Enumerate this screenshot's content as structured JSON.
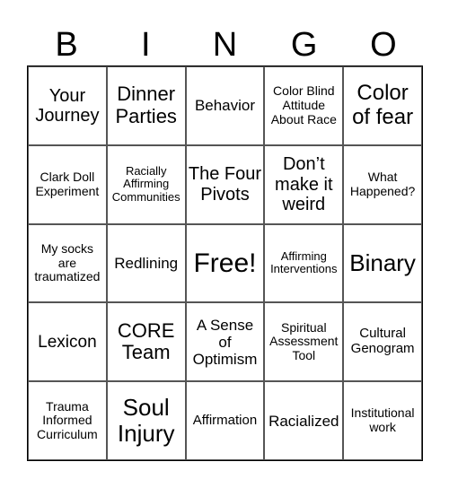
{
  "header": [
    "B",
    "I",
    "N",
    "G",
    "O"
  ],
  "cells": [
    [
      "Your Journey",
      "Dinner Parties",
      "Behavior",
      "Color Blind Attitude About Race",
      "Color of fear"
    ],
    [
      "Clark Doll Experiment",
      "Racially Affirming Communities",
      "The Four Pivots",
      "Don’t make it weird",
      "What Happened?"
    ],
    [
      "My socks are traumatized",
      "Redlining",
      "Free!",
      "Affirming Interventions",
      "Binary"
    ],
    [
      "Lexicon",
      "CORE Team",
      "A Sense of Optimism",
      "Spiritual Assessment Tool",
      "Cultural Genogram"
    ],
    [
      "Trauma Informed Curriculum",
      "Soul Injury",
      "Affirmation",
      "Racialized",
      "Institutional work"
    ]
  ]
}
